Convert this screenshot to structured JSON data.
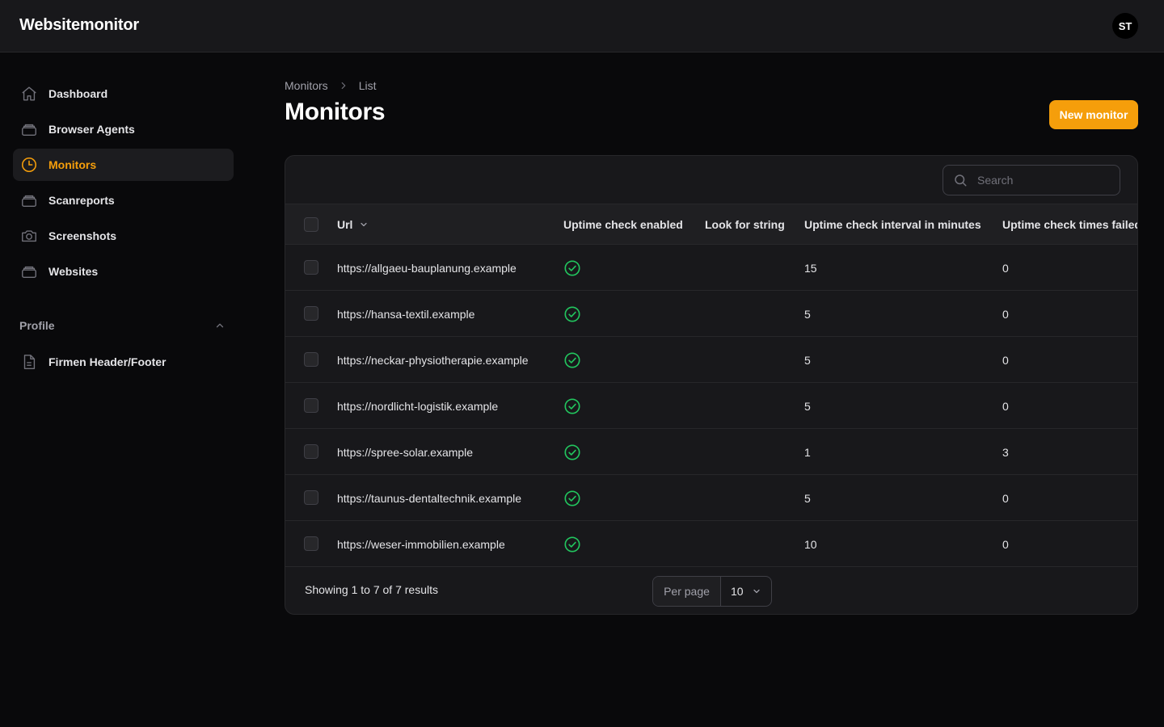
{
  "app": {
    "brand": "Websitemonitor",
    "user_initials": "ST"
  },
  "sidebar": {
    "items": [
      {
        "label": "Dashboard",
        "icon": "home-icon"
      },
      {
        "label": "Browser Agents",
        "icon": "stack-icon"
      },
      {
        "label": "Monitors",
        "icon": "clock-icon",
        "active": true
      },
      {
        "label": "Scanreports",
        "icon": "stack-icon"
      },
      {
        "label": "Screenshots",
        "icon": "camera-icon"
      },
      {
        "label": "Websites",
        "icon": "stack-icon"
      }
    ],
    "group": {
      "label": "Profile",
      "items": [
        {
          "label": "Firmen Header/Footer",
          "icon": "document-icon"
        }
      ]
    }
  },
  "breadcrumb": {
    "items": [
      "Monitors",
      "List"
    ]
  },
  "page": {
    "title": "Monitors",
    "new_button": "New monitor"
  },
  "table": {
    "search_placeholder": "Search",
    "columns": [
      "Url",
      "Uptime check enabled",
      "Look for string",
      "Uptime check interval in minutes",
      "Uptime check times failed"
    ],
    "rows": [
      {
        "url": "https://allgaeu-bauplanung.example",
        "enabled": true,
        "look_for": "",
        "interval": "15",
        "failed": "0"
      },
      {
        "url": "https://hansa-textil.example",
        "enabled": true,
        "look_for": "",
        "interval": "5",
        "failed": "0"
      },
      {
        "url": "https://neckar-physiotherapie.example",
        "enabled": true,
        "look_for": "",
        "interval": "5",
        "failed": "0"
      },
      {
        "url": "https://nordlicht-logistik.example",
        "enabled": true,
        "look_for": "",
        "interval": "5",
        "failed": "0"
      },
      {
        "url": "https://spree-solar.example",
        "enabled": true,
        "look_for": "",
        "interval": "1",
        "failed": "3"
      },
      {
        "url": "https://taunus-dentaltechnik.example",
        "enabled": true,
        "look_for": "",
        "interval": "5",
        "failed": "0"
      },
      {
        "url": "https://weser-immobilien.example",
        "enabled": true,
        "look_for": "",
        "interval": "10",
        "failed": "0"
      }
    ],
    "footer": {
      "summary": "Showing 1 to 7 of 7 results",
      "per_page_label": "Per page",
      "per_page_value": "10"
    }
  },
  "colors": {
    "accent": "#f59e0b",
    "success": "#22c55e",
    "background": "#09090b",
    "surface": "#18181b"
  }
}
